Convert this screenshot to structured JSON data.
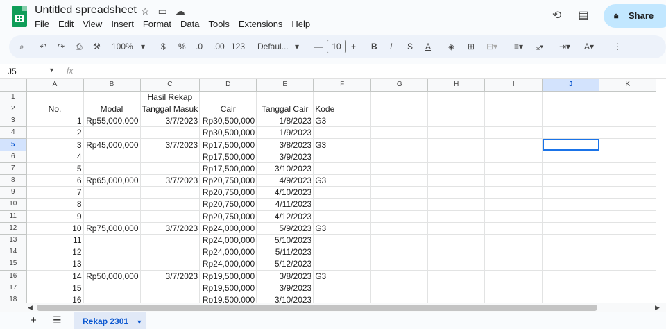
{
  "app": {
    "title": "Untitled spreadsheet",
    "menus": [
      "File",
      "Edit",
      "View",
      "Insert",
      "Format",
      "Data",
      "Tools",
      "Extensions",
      "Help"
    ],
    "share_label": "Share"
  },
  "toolbar": {
    "zoom": "100%",
    "currency": "$",
    "percent": "%",
    "decrease_decimal": ".0",
    "increase_decimal": ".00",
    "number_format": "123",
    "font": "Defaul...",
    "font_size": "10"
  },
  "formula_bar": {
    "cell_ref": "J5",
    "fx": "fx",
    "value": ""
  },
  "columns": [
    "A",
    "B",
    "C",
    "D",
    "E",
    "F",
    "G",
    "H",
    "I",
    "J",
    "K"
  ],
  "selected_column": "J",
  "selected_row": 5,
  "rows": [
    {
      "n": "1",
      "cells": [
        "",
        "",
        "Hasil Rekap",
        "",
        "",
        "",
        "",
        "",
        "",
        "",
        ""
      ]
    },
    {
      "n": "2",
      "cells": [
        "No.",
        "Modal",
        "Tanggal Masuk",
        "Cair",
        "Tanggal Cair",
        "Kode",
        "",
        "",
        "",
        "",
        ""
      ]
    },
    {
      "n": "3",
      "cells": [
        "1",
        "Rp55,000,000",
        "3/7/2023",
        "Rp30,500,000",
        "1/8/2023",
        "G3",
        "",
        "",
        "",
        "",
        ""
      ]
    },
    {
      "n": "4",
      "cells": [
        "2",
        "",
        "",
        "Rp30,500,000",
        "1/9/2023",
        "",
        "",
        "",
        "",
        "",
        ""
      ]
    },
    {
      "n": "5",
      "cells": [
        "3",
        "Rp45,000,000",
        "3/7/2023",
        "Rp17,500,000",
        "3/8/2023",
        "G3",
        "",
        "",
        "",
        "",
        ""
      ]
    },
    {
      "n": "6",
      "cells": [
        "4",
        "",
        "",
        "Rp17,500,000",
        "3/9/2023",
        "",
        "",
        "",
        "",
        "",
        ""
      ]
    },
    {
      "n": "7",
      "cells": [
        "5",
        "",
        "",
        "Rp17,500,000",
        "3/10/2023",
        "",
        "",
        "",
        "",
        "",
        ""
      ]
    },
    {
      "n": "8",
      "cells": [
        "6",
        "Rp65,000,000",
        "3/7/2023",
        "Rp20,750,000",
        "4/9/2023",
        "G3",
        "",
        "",
        "",
        "",
        ""
      ]
    },
    {
      "n": "9",
      "cells": [
        "7",
        "",
        "",
        "Rp20,750,000",
        "4/10/2023",
        "",
        "",
        "",
        "",
        "",
        ""
      ]
    },
    {
      "n": "10",
      "cells": [
        "8",
        "",
        "",
        "Rp20,750,000",
        "4/11/2023",
        "",
        "",
        "",
        "",
        "",
        ""
      ]
    },
    {
      "n": "11",
      "cells": [
        "9",
        "",
        "",
        "Rp20,750,000",
        "4/12/2023",
        "",
        "",
        "",
        "",
        "",
        ""
      ]
    },
    {
      "n": "12",
      "cells": [
        "10",
        "Rp75,000,000",
        "3/7/2023",
        "Rp24,000,000",
        "5/9/2023",
        "G3",
        "",
        "",
        "",
        "",
        ""
      ]
    },
    {
      "n": "13",
      "cells": [
        "11",
        "",
        "",
        "Rp24,000,000",
        "5/10/2023",
        "",
        "",
        "",
        "",
        "",
        ""
      ]
    },
    {
      "n": "14",
      "cells": [
        "12",
        "",
        "",
        "Rp24,000,000",
        "5/11/2023",
        "",
        "",
        "",
        "",
        "",
        ""
      ]
    },
    {
      "n": "15",
      "cells": [
        "13",
        "",
        "",
        "Rp24,000,000",
        "5/12/2023",
        "",
        "",
        "",
        "",
        "",
        ""
      ]
    },
    {
      "n": "16",
      "cells": [
        "14",
        "Rp50,000,000",
        "3/7/2023",
        "Rp19,500,000",
        "3/8/2023",
        "G3",
        "",
        "",
        "",
        "",
        ""
      ]
    },
    {
      "n": "17",
      "cells": [
        "15",
        "",
        "",
        "Rp19,500,000",
        "3/9/2023",
        "",
        "",
        "",
        "",
        "",
        ""
      ]
    },
    {
      "n": "18",
      "cells": [
        "16",
        "",
        "",
        "Rp19,500,000",
        "3/10/2023",
        "",
        "",
        "",
        "",
        "",
        ""
      ]
    }
  ],
  "sheet_tab": "Rekap 2301"
}
